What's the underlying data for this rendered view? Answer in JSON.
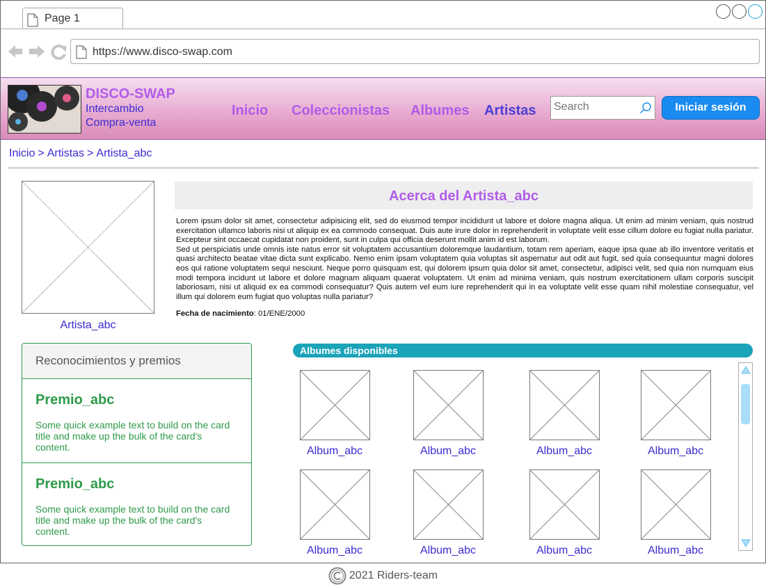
{
  "browser": {
    "tab_label": "Page 1",
    "url": "https://www.disco-swap.com"
  },
  "brand": {
    "name": "DISCO-SWAP",
    "tagline1": "Intercambio",
    "tagline2": "Compra-venta"
  },
  "nav": {
    "items": [
      {
        "label": "Inicio"
      },
      {
        "label": "Coleccionistas"
      },
      {
        "label": "Albumes"
      },
      {
        "label": "Artistas"
      }
    ],
    "search_placeholder": "Search",
    "login_label": "Iniciar sesión"
  },
  "breadcrumb": [
    "Inicio",
    "Artistas",
    "Artista_abc"
  ],
  "artist": {
    "caption": "Artista_abc",
    "about_title": "Acerca del Artista_abc",
    "about_p1": "Lorem ipsum dolor sit amet, consectetur adipisicing elit, sed do eiusmod tempor incididunt ut labore et dolore magna aliqua. Ut enim ad minim veniam, quis nostrud exercitation ullamco laboris nisi ut aliquip ex ea commodo consequat. Duis aute irure dolor in reprehenderit in voluptate velit esse cillum dolore eu fugiat nulla pariatur. Excepteur sint occaecat cupidatat non proident, sunt in culpa qui officia deserunt mollit anim id est laborum.",
    "about_p2": "Sed ut perspiciatis unde omnis iste natus error sit voluptatem accusantium doloremque laudantium, totam rem aperiam, eaque ipsa quae ab illo inventore veritatis et quasi architecto beatae vitae dicta sunt explicabo. Nemo enim ipsam voluptatem quia voluptas sit aspernatur aut odit aut fugit, sed quia consequuntur magni dolores eos qui ratione voluptatem sequi nesciunt. Neque porro quisquam est, qui dolorem ipsum quia dolor sit amet, consectetur, adipisci velit, sed quia non numquam eius modi tempora incidunt ut labore et dolore magnam aliquam quaerat voluptatem. Ut enim ad minima veniam, quis nostrum exercitationem ullam corporis suscipit laboriosam, nisi ut aliquid ex ea commodi consequatur? Quis autem vel eum iure reprehenderit qui in ea voluptate velit esse quam nihil molestiae consequatur, vel illum qui dolorem eum fugiat quo voluptas nulla pariatur?",
    "birth_label": "Fecha de nacimiento",
    "birth_value": ": 01/ENE/2000"
  },
  "awards": {
    "header": "Reconocimientos y premios",
    "items": [
      {
        "title": "Premio_abc",
        "text": "Some quick example text to build on the card title and make up the bulk of the card's content."
      },
      {
        "title": "Premio_abc",
        "text": "Some quick example text to build on the card title and make up the bulk of the card's content."
      }
    ]
  },
  "albums": {
    "header": "Albumes disponibles",
    "items": [
      "Album_abc",
      "Album_abc",
      "Album_abc",
      "Album_abc",
      "Album_abc",
      "Album_abc",
      "Album_abc",
      "Album_abc"
    ]
  },
  "footer": {
    "text": "2021 Riders-team"
  },
  "colors": {
    "brand_purple": "#b05ce8",
    "link_blue": "#3a2bd0",
    "login_blue": "#1a8bf0",
    "award_green": "#2e9a4a",
    "albums_teal": "#1ba3b8"
  }
}
